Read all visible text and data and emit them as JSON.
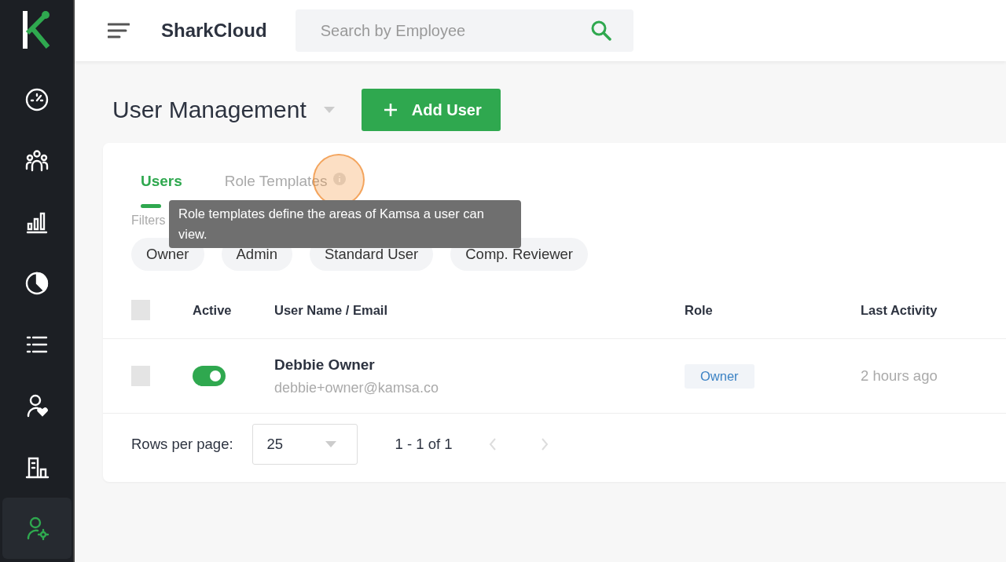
{
  "app": {
    "name": "SharkCloud"
  },
  "sidebar": {
    "items": [
      {
        "kind": "gauge",
        "selected": false
      },
      {
        "kind": "people",
        "selected": false
      },
      {
        "kind": "bars",
        "selected": false
      },
      {
        "kind": "pie",
        "selected": false
      },
      {
        "kind": "list",
        "selected": false
      },
      {
        "kind": "favorite",
        "selected": false
      },
      {
        "kind": "building",
        "selected": false
      },
      {
        "kind": "usersettings",
        "selected": true
      }
    ]
  },
  "search": {
    "placeholder": "Search by Employee"
  },
  "page": {
    "title": "User Management",
    "add_button": "Add User"
  },
  "tabs": [
    {
      "label": "Users",
      "selected": true
    },
    {
      "label": "Role Templates",
      "selected": false,
      "info": true
    }
  ],
  "tooltip": "Role templates define the areas of Kamsa a user can view.",
  "filters": {
    "label": "Filters",
    "chips": [
      "Owner",
      "Admin",
      "Standard User",
      "Comp. Reviewer"
    ]
  },
  "table": {
    "select_all": false,
    "columns": [
      "Active",
      "User Name / Email",
      "Role",
      "Last Activity"
    ],
    "rows": [
      {
        "checked": false,
        "active": true,
        "name": "Debbie Owner",
        "email": "debbie+owner@kamsa.co",
        "role": "Owner",
        "last_activity": "2 hours ago"
      }
    ]
  },
  "pagination": {
    "label": "Rows per page:",
    "rows_per_page": "25",
    "range": "1 - 1 of 1"
  }
}
